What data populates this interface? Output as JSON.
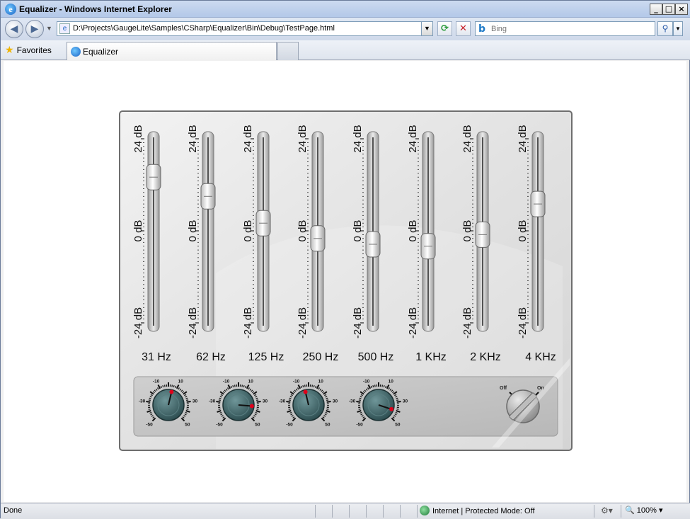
{
  "window": {
    "title": "Equalizer - Windows Internet Explorer"
  },
  "nav": {
    "address": "D:\\Projects\\GaugeLite\\Samples\\CSharp\\Equalizer\\Bin\\Debug\\TestPage.html",
    "search_placeholder": "Bing"
  },
  "favorites": {
    "label": "Favorites"
  },
  "tab": {
    "label": "Equalizer"
  },
  "status": {
    "text": "Done",
    "zone": "Internet | Protected Mode: Off",
    "zoom": "100%"
  },
  "equalizer": {
    "scale_top": "24 dB",
    "scale_mid": "0 dB",
    "scale_bottom": "-24 dB",
    "bands": [
      {
        "label": "31 Hz",
        "value_db": 14
      },
      {
        "label": "62 Hz",
        "value_db": 9
      },
      {
        "label": "125 Hz",
        "value_db": 2
      },
      {
        "label": "250 Hz",
        "value_db": -2
      },
      {
        "label": "500 Hz",
        "value_db": -3.5
      },
      {
        "label": "1 KHz",
        "value_db": -4
      },
      {
        "label": "2 KHz",
        "value_db": -1
      },
      {
        "label": "4 KHz",
        "value_db": 7
      }
    ],
    "knob_labels": {
      "min_left": "-50",
      "min_right": "50",
      "l30": "-30",
      "r30": "30",
      "l10": "-10",
      "r10": "10"
    },
    "knobs": [
      {
        "value": 5
      },
      {
        "value": 35
      },
      {
        "value": -5
      },
      {
        "value": 40
      }
    ],
    "power_switch": {
      "off_label": "Off",
      "on_label": "On",
      "state": "Off"
    },
    "colors": {
      "knob_face": "#3f6568",
      "knob_pointer": "#e0001a",
      "panel": "#e6e6e6"
    }
  }
}
